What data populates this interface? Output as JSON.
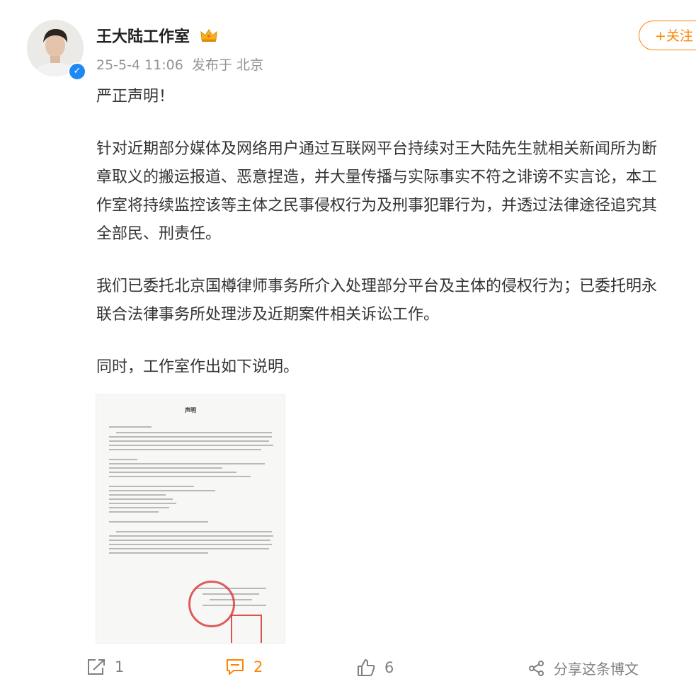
{
  "post": {
    "author": "王大陆工作室",
    "timestamp": "25-5-4 11:06",
    "location_label": "发布于 北京",
    "follow_label": "+关注",
    "paragraphs": [
      [
        "严正声明！"
      ],
      [
        "针对近期部分媒体及网络用户通过互联网平台持续对王大陆先生就相关新闻所为断",
        "章取义的搬运报道、恶意捏造，并大量传播与实际事实不符之诽谤不实言论，本工",
        "作室将持续监控该等主体之民事侵权行为及刑事犯罪行为，并透过法律途径追究其",
        "全部民、刑责任。"
      ],
      [
        "我们已委托北京国樽律师事务所介入处理部分平台及主体的侵权行为；已委托明永",
        "联合法律事务所处理涉及近期案件相关诉讼工作。"
      ],
      [
        "同时，工作室作出如下说明。"
      ]
    ],
    "attachment_title": "声明"
  },
  "actions": {
    "forward_count": "1",
    "comment_count": "2",
    "like_count": "6",
    "share_label": "分享这条博文"
  },
  "colors": {
    "accent": "#ff8200",
    "verified": "#1e88f5",
    "muted_text": "#939393",
    "stamp_red": "#d62828"
  },
  "icons": [
    "crown-icon",
    "verified-icon",
    "forward-icon",
    "comment-icon",
    "like-icon",
    "share-icon"
  ]
}
